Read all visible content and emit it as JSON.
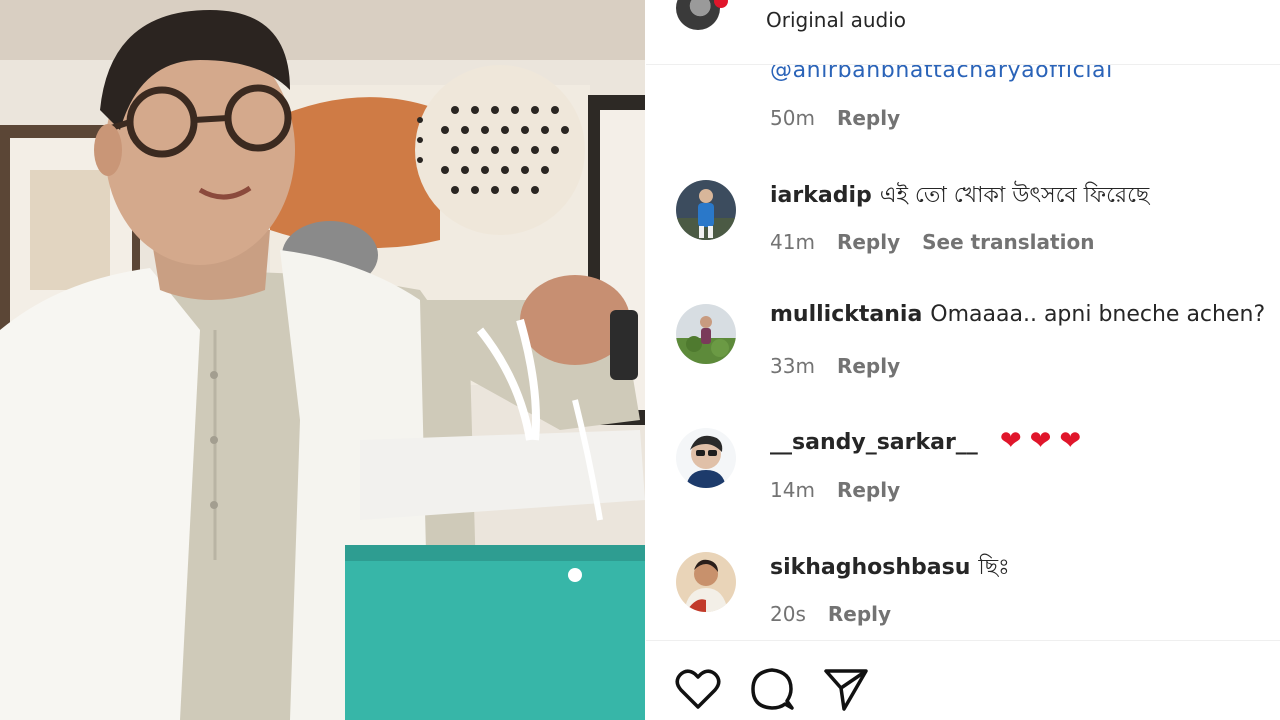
{
  "header": {
    "audio_label": "Original audio"
  },
  "caption": {
    "mention": "@anirbanbhattacharyaofficial",
    "time": "50m",
    "reply": "Reply"
  },
  "comments": [
    {
      "username": "iarkadip",
      "text": "এই তো খোকা উৎসবে ফিরেছে",
      "time": "41m",
      "reply": "Reply",
      "translate": "See translation"
    },
    {
      "username": "mullicktania",
      "text": "Omaaaa.. apni bneche achen?",
      "time": "33m",
      "reply": "Reply"
    },
    {
      "username": "__sandy_sarkar__",
      "text": "❤❤❤",
      "time": "14m",
      "reply": "Reply"
    },
    {
      "username": "sikhaghoshbasu",
      "text": "ছিঃ",
      "time": "20s",
      "reply": "Reply"
    }
  ],
  "actions": {
    "like_icon": "heart-icon",
    "comment_icon": "comment-icon",
    "share_icon": "share-icon"
  },
  "colors": {
    "link": "#2a63b8",
    "heart": "#e0162b",
    "muted": "#737373"
  }
}
